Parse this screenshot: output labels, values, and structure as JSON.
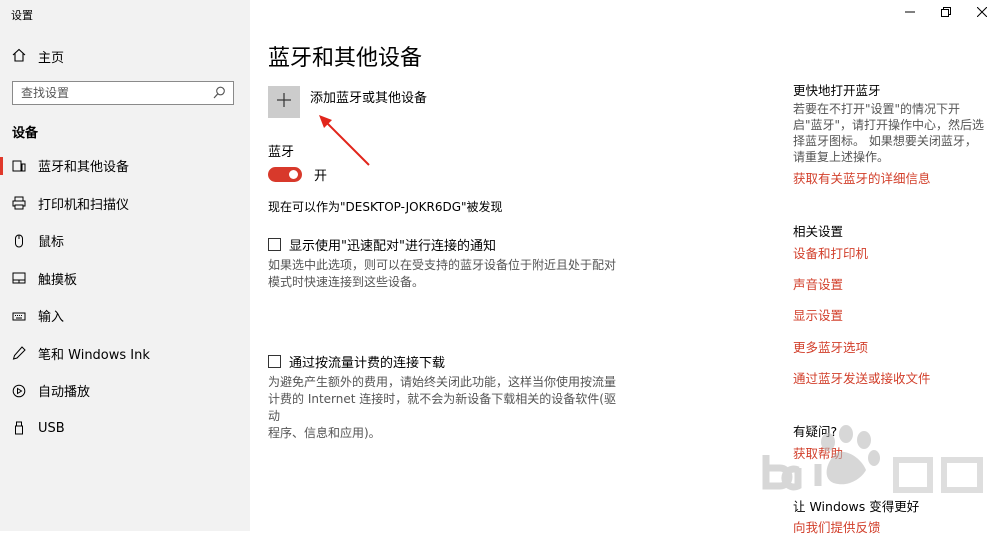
{
  "window": {
    "title": "设置"
  },
  "sidebar": {
    "home_label": "主页",
    "search_placeholder": "查找设置",
    "section_label": "设备",
    "items": [
      {
        "label": "蓝牙和其他设备",
        "icon": "bluetooth-devices-icon",
        "active": true
      },
      {
        "label": "打印机和扫描仪",
        "icon": "printer-icon",
        "active": false
      },
      {
        "label": "鼠标",
        "icon": "mouse-icon",
        "active": false
      },
      {
        "label": "触摸板",
        "icon": "touchpad-icon",
        "active": false
      },
      {
        "label": "输入",
        "icon": "keyboard-icon",
        "active": false
      },
      {
        "label": "笔和 Windows Ink",
        "icon": "pen-icon",
        "active": false
      },
      {
        "label": "自动播放",
        "icon": "autoplay-icon",
        "active": false
      },
      {
        "label": "USB",
        "icon": "usb-icon",
        "active": false
      }
    ]
  },
  "main": {
    "title": "蓝牙和其他设备",
    "add_device_label": "添加蓝牙或其他设备",
    "bluetooth_label": "蓝牙",
    "bluetooth_state": "开",
    "discoverable_text": "现在可以作为\"DESKTOP-JOKR6DG\"被发现",
    "swift_pair": {
      "label": "显示使用\"迅速配对\"进行连接的通知",
      "checked": false,
      "desc_line1": "如果选中此选项，则可以在受支持的蓝牙设备位于附近且处于配对",
      "desc_line2": "模式时快速连接到这些设备。"
    },
    "metered": {
      "label": "通过按流量计费的连接下载",
      "checked": false,
      "desc_line1": "为避免产生额外的费用，请始终关闭此功能，这样当你使用按流量",
      "desc_line2": "计费的 Internet 连接时，就不会为新设备下载相关的设备软件(驱动",
      "desc_line3": "程序、信息和应用)。"
    }
  },
  "right": {
    "quick_head": "更快地打开蓝牙",
    "quick_text1": "若要在不打开\"设置\"的情况下开",
    "quick_text2": "启\"蓝牙\"，请打开操作中心，然后选",
    "quick_text3": "择蓝牙图标。 如果想要关闭蓝牙，",
    "quick_text4": "请重复上述操作。",
    "quick_link": "获取有关蓝牙的详细信息",
    "related_head": "相关设置",
    "related_links": [
      "设备和打印机",
      "声音设置",
      "显示设置",
      "更多蓝牙选项",
      "通过蓝牙发送或接收文件"
    ],
    "question_head": "有疑问?",
    "help_link": "获取帮助",
    "improve_head": "让 Windows 变得更好",
    "feedback_link": "向我们提供反馈"
  },
  "colors": {
    "accent": "#d8392b",
    "sidebar_bg": "#f2f2f2",
    "link": "#d23f2b"
  }
}
